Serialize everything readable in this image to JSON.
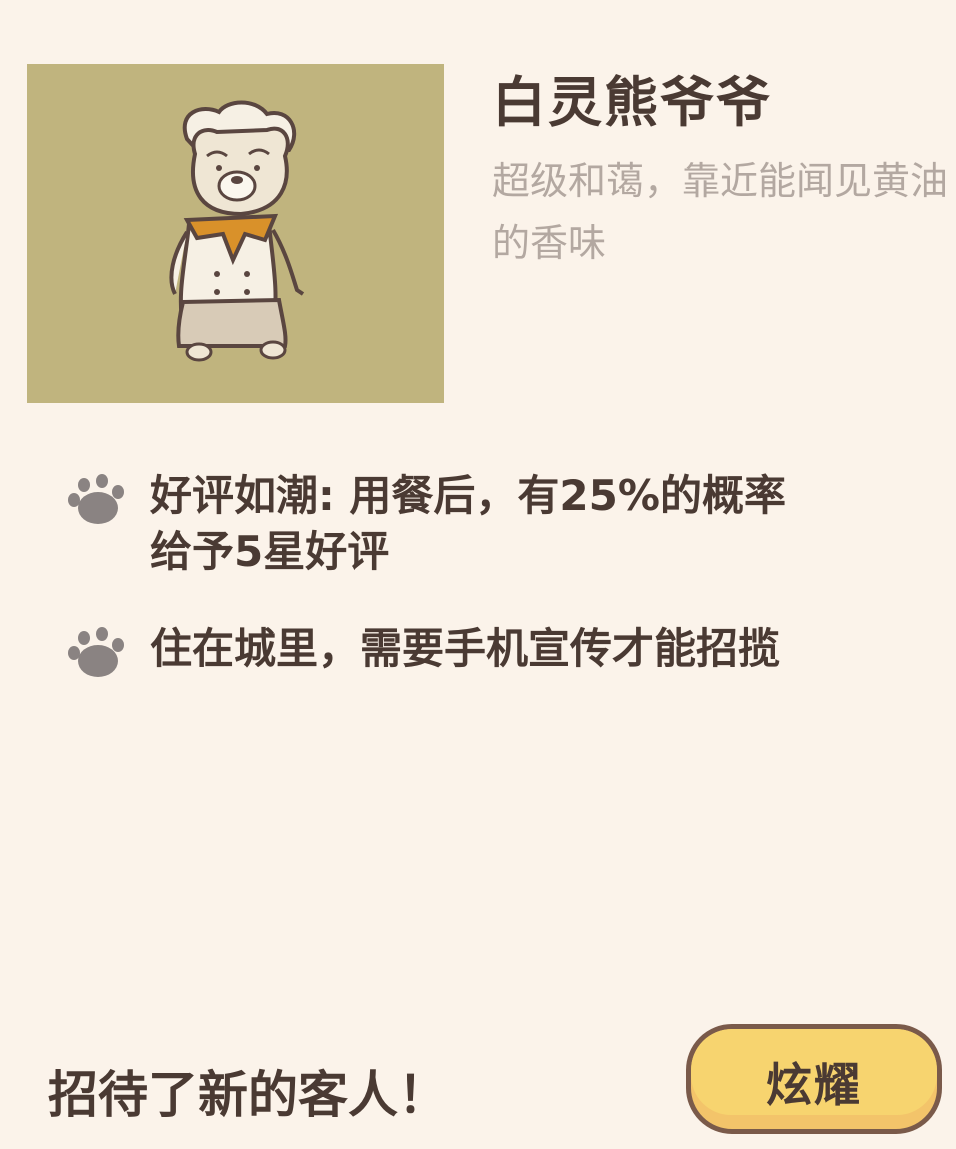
{
  "character": {
    "name": "白灵熊爷爷",
    "description": "超级和蔼，靠近能闻见黄油的香味",
    "portrait_icon": "bear-chef-icon",
    "portrait_bg": "#c0b47e"
  },
  "traits": [
    {
      "icon": "paw-icon",
      "text": "好评如潮: 用餐后，有25%的概率\n给予5星好评"
    },
    {
      "icon": "paw-icon",
      "text": "住在城里，需要手机宣传才能招揽"
    }
  ],
  "footer": {
    "message": "招待了新的客人！",
    "share_button_label": "炫耀"
  },
  "colors": {
    "background": "#fbf3ea",
    "text_dark": "#4a3a33",
    "text_muted": "#b3a8a1",
    "button_fill": "#f7d46f",
    "button_border": "#7a5a4a"
  }
}
